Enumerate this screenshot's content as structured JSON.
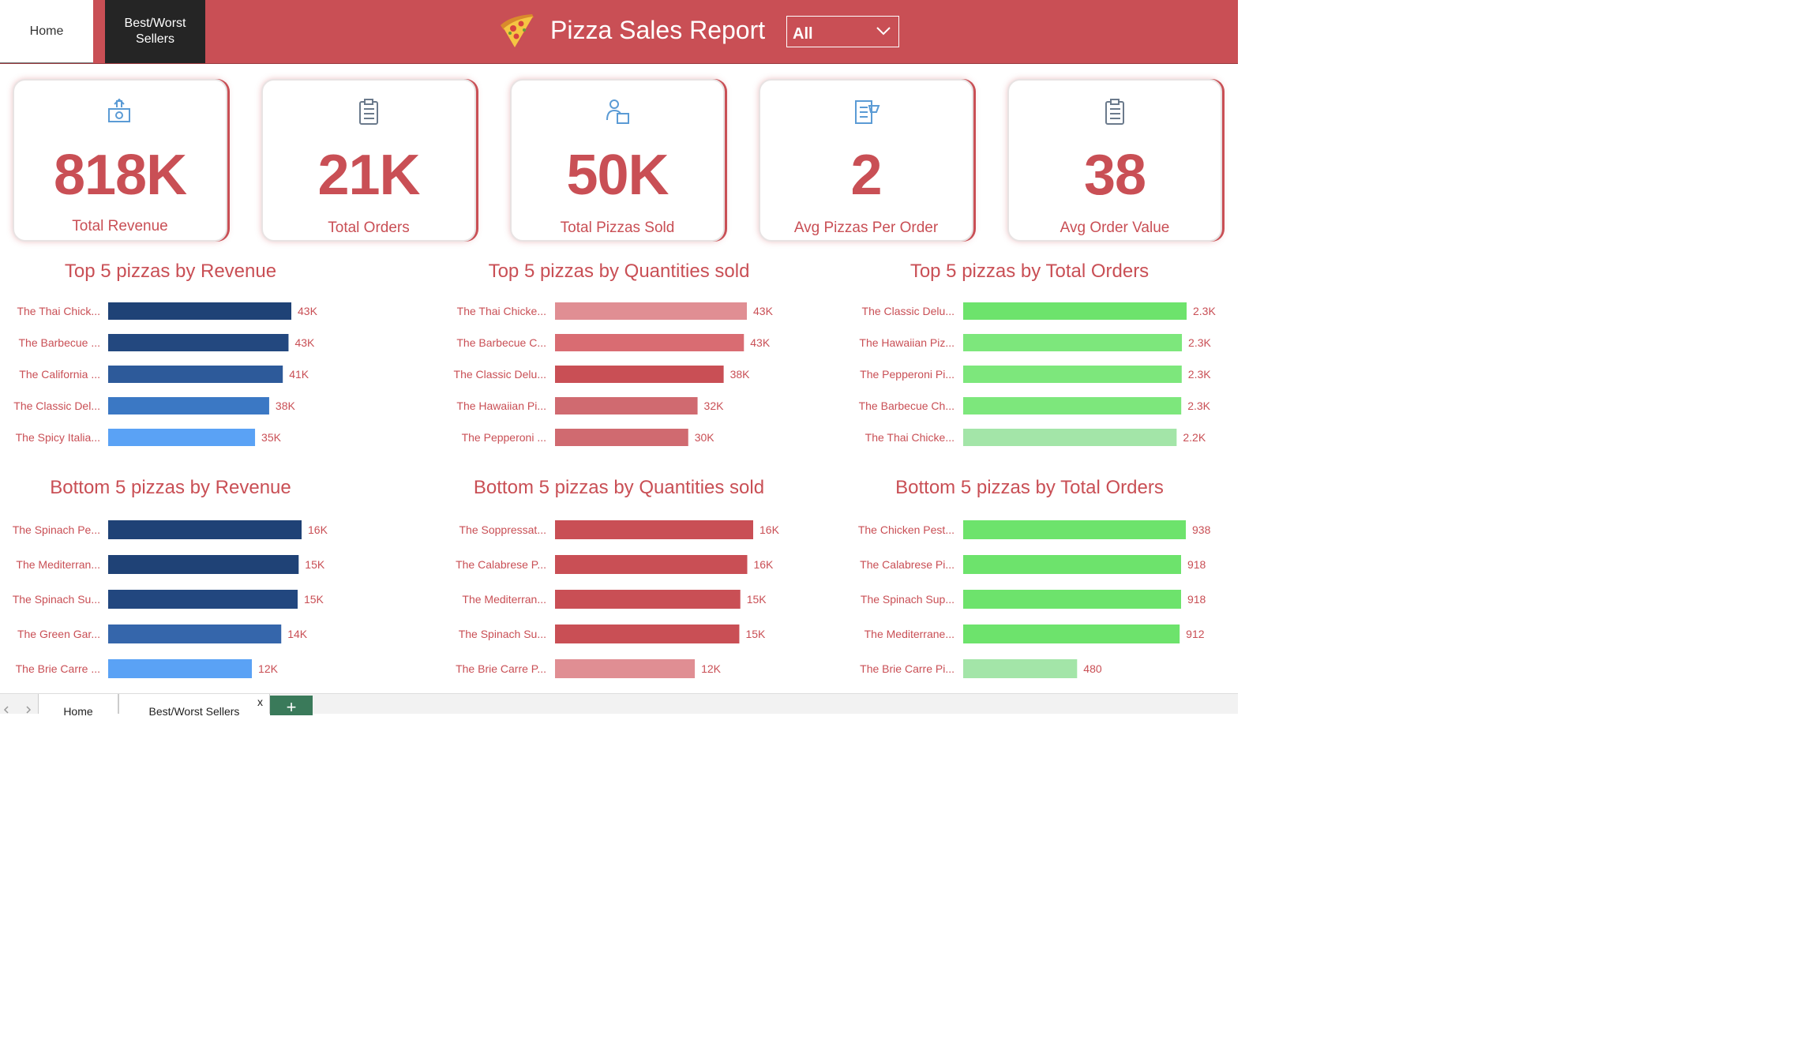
{
  "nav": {
    "home_label": "Home",
    "best_worst_label": "Best/Worst\nSellers"
  },
  "header": {
    "title": "Pizza Sales Report",
    "slicer_value": "All"
  },
  "colors": {
    "brand": "#c94f55",
    "dark": "#252525"
  },
  "kpis": [
    {
      "value": "818K",
      "label": "Total Revenue",
      "icon": "money-icon"
    },
    {
      "value": "21K",
      "label": "Total Orders",
      "icon": "clipboard-icon"
    },
    {
      "value": "50K",
      "label": "Total Pizzas Sold",
      "icon": "delivery-icon"
    },
    {
      "value": "2",
      "label": "Avg Pizzas Per Order",
      "icon": "checklist-icon"
    },
    {
      "value": "38",
      "label": "Avg Order Value",
      "icon": "clipboard-icon"
    }
  ],
  "chart_data": [
    {
      "type": "bar",
      "title": "Top 5 pizzas by Revenue",
      "categories": [
        "The Thai Chick...",
        "The Barbecue ...",
        "The California ...",
        "The Classic Del...",
        "The Spicy Italia..."
      ],
      "values": [
        43434,
        42768,
        41410,
        38180,
        34831
      ],
      "data_labels": [
        "43K",
        "43K",
        "41K",
        "38K",
        "35K"
      ],
      "colors": [
        "#1f4276",
        "#23487f",
        "#2d5a9a",
        "#3b78c4",
        "#5aa2f5"
      ]
    },
    {
      "type": "bar",
      "title": "Top 5 pizzas by Quantities sold",
      "categories": [
        "The Thai Chicke...",
        "The Barbecue C...",
        "The Classic Delu...",
        "The Hawaiian Pi...",
        "The Pepperoni ..."
      ],
      "values": [
        43434,
        42768,
        38180,
        32273,
        30162
      ],
      "data_labels": [
        "43K",
        "43K",
        "38K",
        "32K",
        "30K"
      ],
      "colors": [
        "#e08e93",
        "#d96c72",
        "#c94f55",
        "#d06a70",
        "#d06a70"
      ]
    },
    {
      "type": "bar",
      "title": "Top 5 pizzas by Total Orders",
      "categories": [
        "The Classic Delu...",
        "The Hawaiian Piz...",
        "The Pepperoni Pi...",
        "The Barbecue Ch...",
        "The Thai Chicke..."
      ],
      "values": [
        2329,
        2280,
        2278,
        2273,
        2225
      ],
      "data_labels": [
        "2.3K",
        "2.3K",
        "2.3K",
        "2.3K",
        "2.2K"
      ],
      "colors": [
        "#6de36c",
        "#7de77c",
        "#7de77c",
        "#7de77c",
        "#a3e5a8"
      ]
    },
    {
      "type": "bar",
      "title": "Bottom 5 pizzas by Revenue",
      "categories": [
        "The Spinach Pe...",
        "The Mediterran...",
        "The Spinach Su...",
        "The Green Gar...",
        "The Brie Carre ..."
      ],
      "values": [
        15596,
        15360,
        15277,
        13956,
        11588
      ],
      "data_labels": [
        "16K",
        "15K",
        "15K",
        "14K",
        "12K"
      ],
      "colors": [
        "#1f4276",
        "#1f4276",
        "#22477f",
        "#3566ab",
        "#5aa2f5"
      ]
    },
    {
      "type": "bar",
      "title": "Bottom 5 pizzas by Quantities sold",
      "categories": [
        "The Soppressat...",
        "The Calabrese P...",
        "The Mediterran...",
        "The Spinach Su...",
        "The Brie Carre P..."
      ],
      "values": [
        16425,
        15934,
        15360,
        15277,
        11588
      ],
      "data_labels": [
        "16K",
        "16K",
        "15K",
        "15K",
        "12K"
      ],
      "colors": [
        "#c94f55",
        "#c94f55",
        "#c94f55",
        "#c94f55",
        "#e08e93"
      ]
    },
    {
      "type": "bar",
      "title": "Bottom 5 pizzas by Total Orders",
      "categories": [
        "The Chicken Pest...",
        "The Calabrese Pi...",
        "The Spinach Sup...",
        "The Mediterrane...",
        "The Brie Carre Pi..."
      ],
      "values": [
        938,
        918,
        918,
        912,
        480
      ],
      "data_labels": [
        "938",
        "918",
        "918",
        "912",
        "480"
      ],
      "colors": [
        "#6de36c",
        "#6de36c",
        "#6de36c",
        "#6de36c",
        "#a3e5a8"
      ]
    }
  ],
  "sheet_tabs": {
    "home": "Home",
    "best_worst": "Best/Worst Sellers",
    "close": "x",
    "add": "+"
  }
}
